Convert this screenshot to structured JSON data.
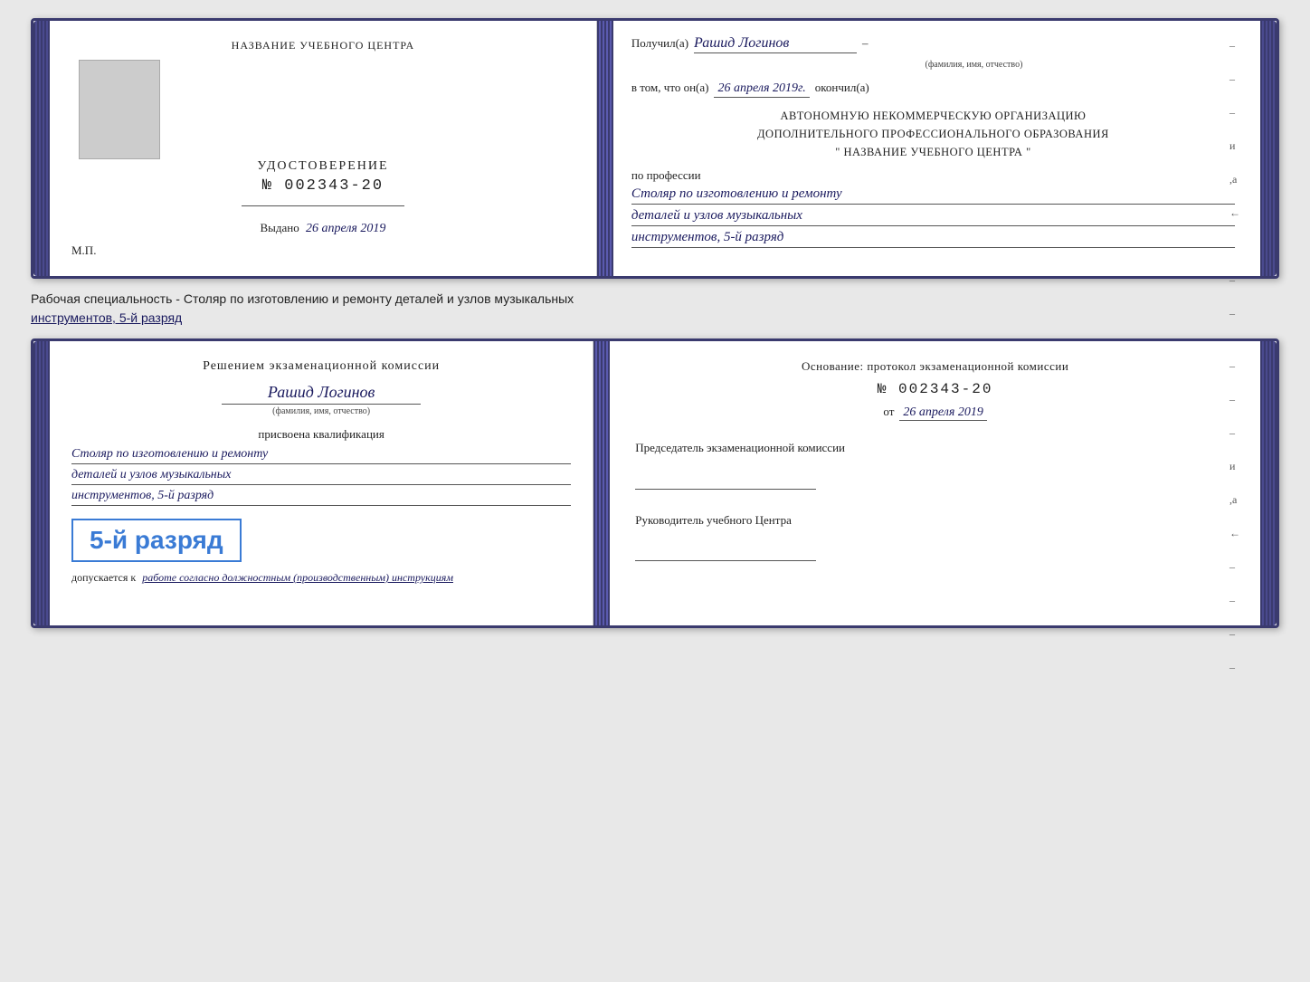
{
  "top_doc": {
    "left": {
      "title": "НАЗВАНИЕ УЧЕБНОГО ЦЕНТРА",
      "cert_label": "УДОСТОВЕРЕНИЕ",
      "cert_number": "№ 002343-20",
      "vydano_label": "Выдано",
      "vydano_date": "26 апреля 2019",
      "mp_label": "М.П."
    },
    "right": {
      "poluchil_label": "Получил(а)",
      "recipient_name": "Рашид Логинов",
      "fio_label": "(фамилия, имя, отчество)",
      "v_tom_label": "в том, что он(а)",
      "v_tom_date": "26 апреля 2019г.",
      "okonchil_label": "окончил(а)",
      "org_line1": "АВТОНОМНУЮ НЕКОММЕРЧЕСКУЮ ОРГАНИЗАЦИЮ",
      "org_line2": "ДОПОЛНИТЕЛЬНОГО ПРОФЕССИОНАЛЬНОГО ОБРАЗОВАНИЯ",
      "org_line3": "\"   НАЗВАНИЕ УЧЕБНОГО ЦЕНТРА   \"",
      "po_professii_label": "по профессии",
      "profession_line1": "Столяр по изготовлению и ремонту",
      "profession_line2": "деталей и узлов музыкальных",
      "profession_line3": "инструментов, 5-й разряд",
      "dashes": [
        "-",
        "-",
        "-",
        "и",
        ",а",
        "←",
        "-",
        "-",
        "-",
        "-",
        "-"
      ]
    }
  },
  "caption": {
    "text_before": "Рабочая специальность - Столяр по изготовлению и ремонту деталей и узлов музыкальных",
    "text_underlined": "инструментов, 5-й разряд"
  },
  "bottom_doc": {
    "left": {
      "resheniem_label": "Решением экзаменационной комиссии",
      "name": "Рашид Логинов",
      "fio_label": "(фамилия, имя, отчество)",
      "prisvoyena_label": "присвоена квалификация",
      "qual_line1": "Столяр по изготовлению и ремонту",
      "qual_line2": "деталей и узлов музыкальных",
      "qual_line3": "инструментов, 5-й разряд",
      "highlighted_rank": "5-й разряд",
      "dopuskaetsya_label": "допускается к",
      "dopuskaetsya_val": "работе согласно должностным (производственным) инструкциям"
    },
    "right": {
      "osnovanie_label": "Основание: протокол экзаменационной комиссии",
      "protocol_number": "№ 002343-20",
      "ot_label": "от",
      "ot_date": "26 апреля 2019",
      "predsedatel_label": "Председатель экзаменационной комиссии",
      "rukovoditel_label": "Руководитель учебного Центра",
      "dashes": [
        "-",
        "-",
        "-",
        "и",
        ",а",
        "←",
        "-",
        "-",
        "-",
        "-"
      ]
    }
  }
}
